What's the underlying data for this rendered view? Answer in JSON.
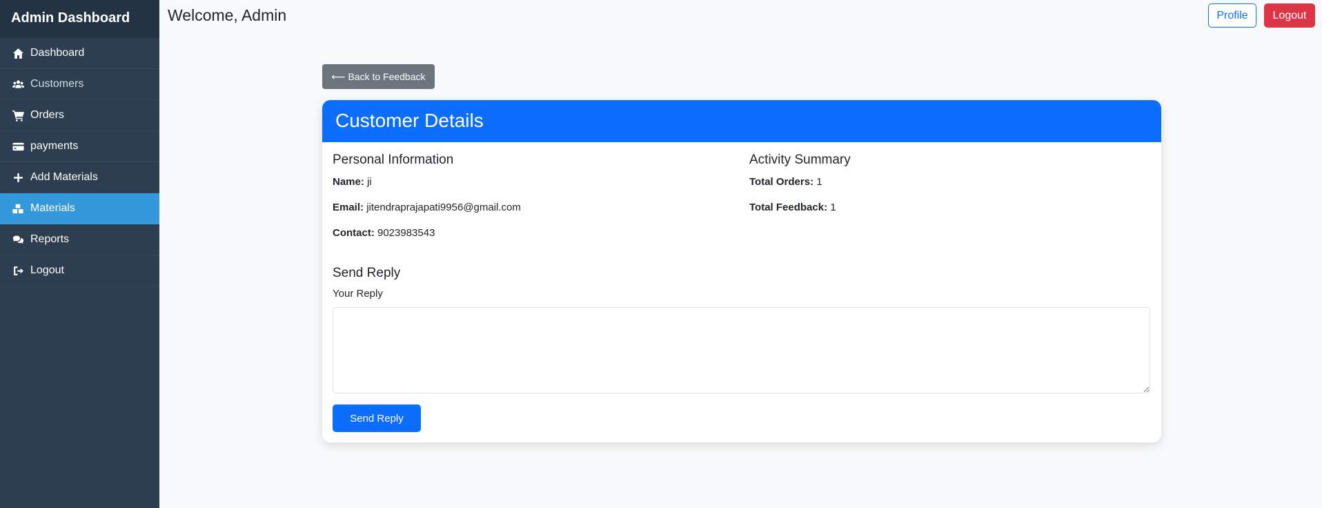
{
  "sidebar": {
    "brand": "Admin Dashboard",
    "items": [
      {
        "label": "Dashboard",
        "icon": "home-icon"
      },
      {
        "label": "Customers",
        "icon": "users-icon"
      },
      {
        "label": "Orders",
        "icon": "cart-icon"
      },
      {
        "label": "payments",
        "icon": "credit-card-icon"
      },
      {
        "label": "Add Materials",
        "icon": "plus-icon"
      },
      {
        "label": "Materials",
        "icon": "boxes-icon",
        "active": true
      },
      {
        "label": "Reports",
        "icon": "comments-icon"
      },
      {
        "label": "Logout",
        "icon": "sign-out-icon"
      }
    ]
  },
  "header": {
    "welcome": "Welcome, Admin",
    "profile_label": "Profile",
    "logout_label": "Logout"
  },
  "back_button_label": "⟵ Back to Feedback",
  "card": {
    "title": "Customer Details",
    "personal": {
      "heading": "Personal Information",
      "name_label": "Name:",
      "name_value": "ji",
      "email_label": "Email:",
      "email_value": "jitendraprajapati9956@gmail.com",
      "contact_label": "Contact:",
      "contact_value": "9023983543"
    },
    "activity": {
      "heading": "Activity Summary",
      "orders_label": "Total Orders:",
      "orders_value": "1",
      "feedback_label": "Total Feedback:",
      "feedback_value": "1"
    },
    "reply": {
      "heading": "Send Reply",
      "label": "Your Reply",
      "value": "",
      "button_label": "Send Reply"
    }
  },
  "colors": {
    "sidebar_bg": "#2c3e50",
    "active_item": "#3498db",
    "primary": "#0d6efd",
    "danger": "#dc3545",
    "secondary": "#6c757d"
  }
}
